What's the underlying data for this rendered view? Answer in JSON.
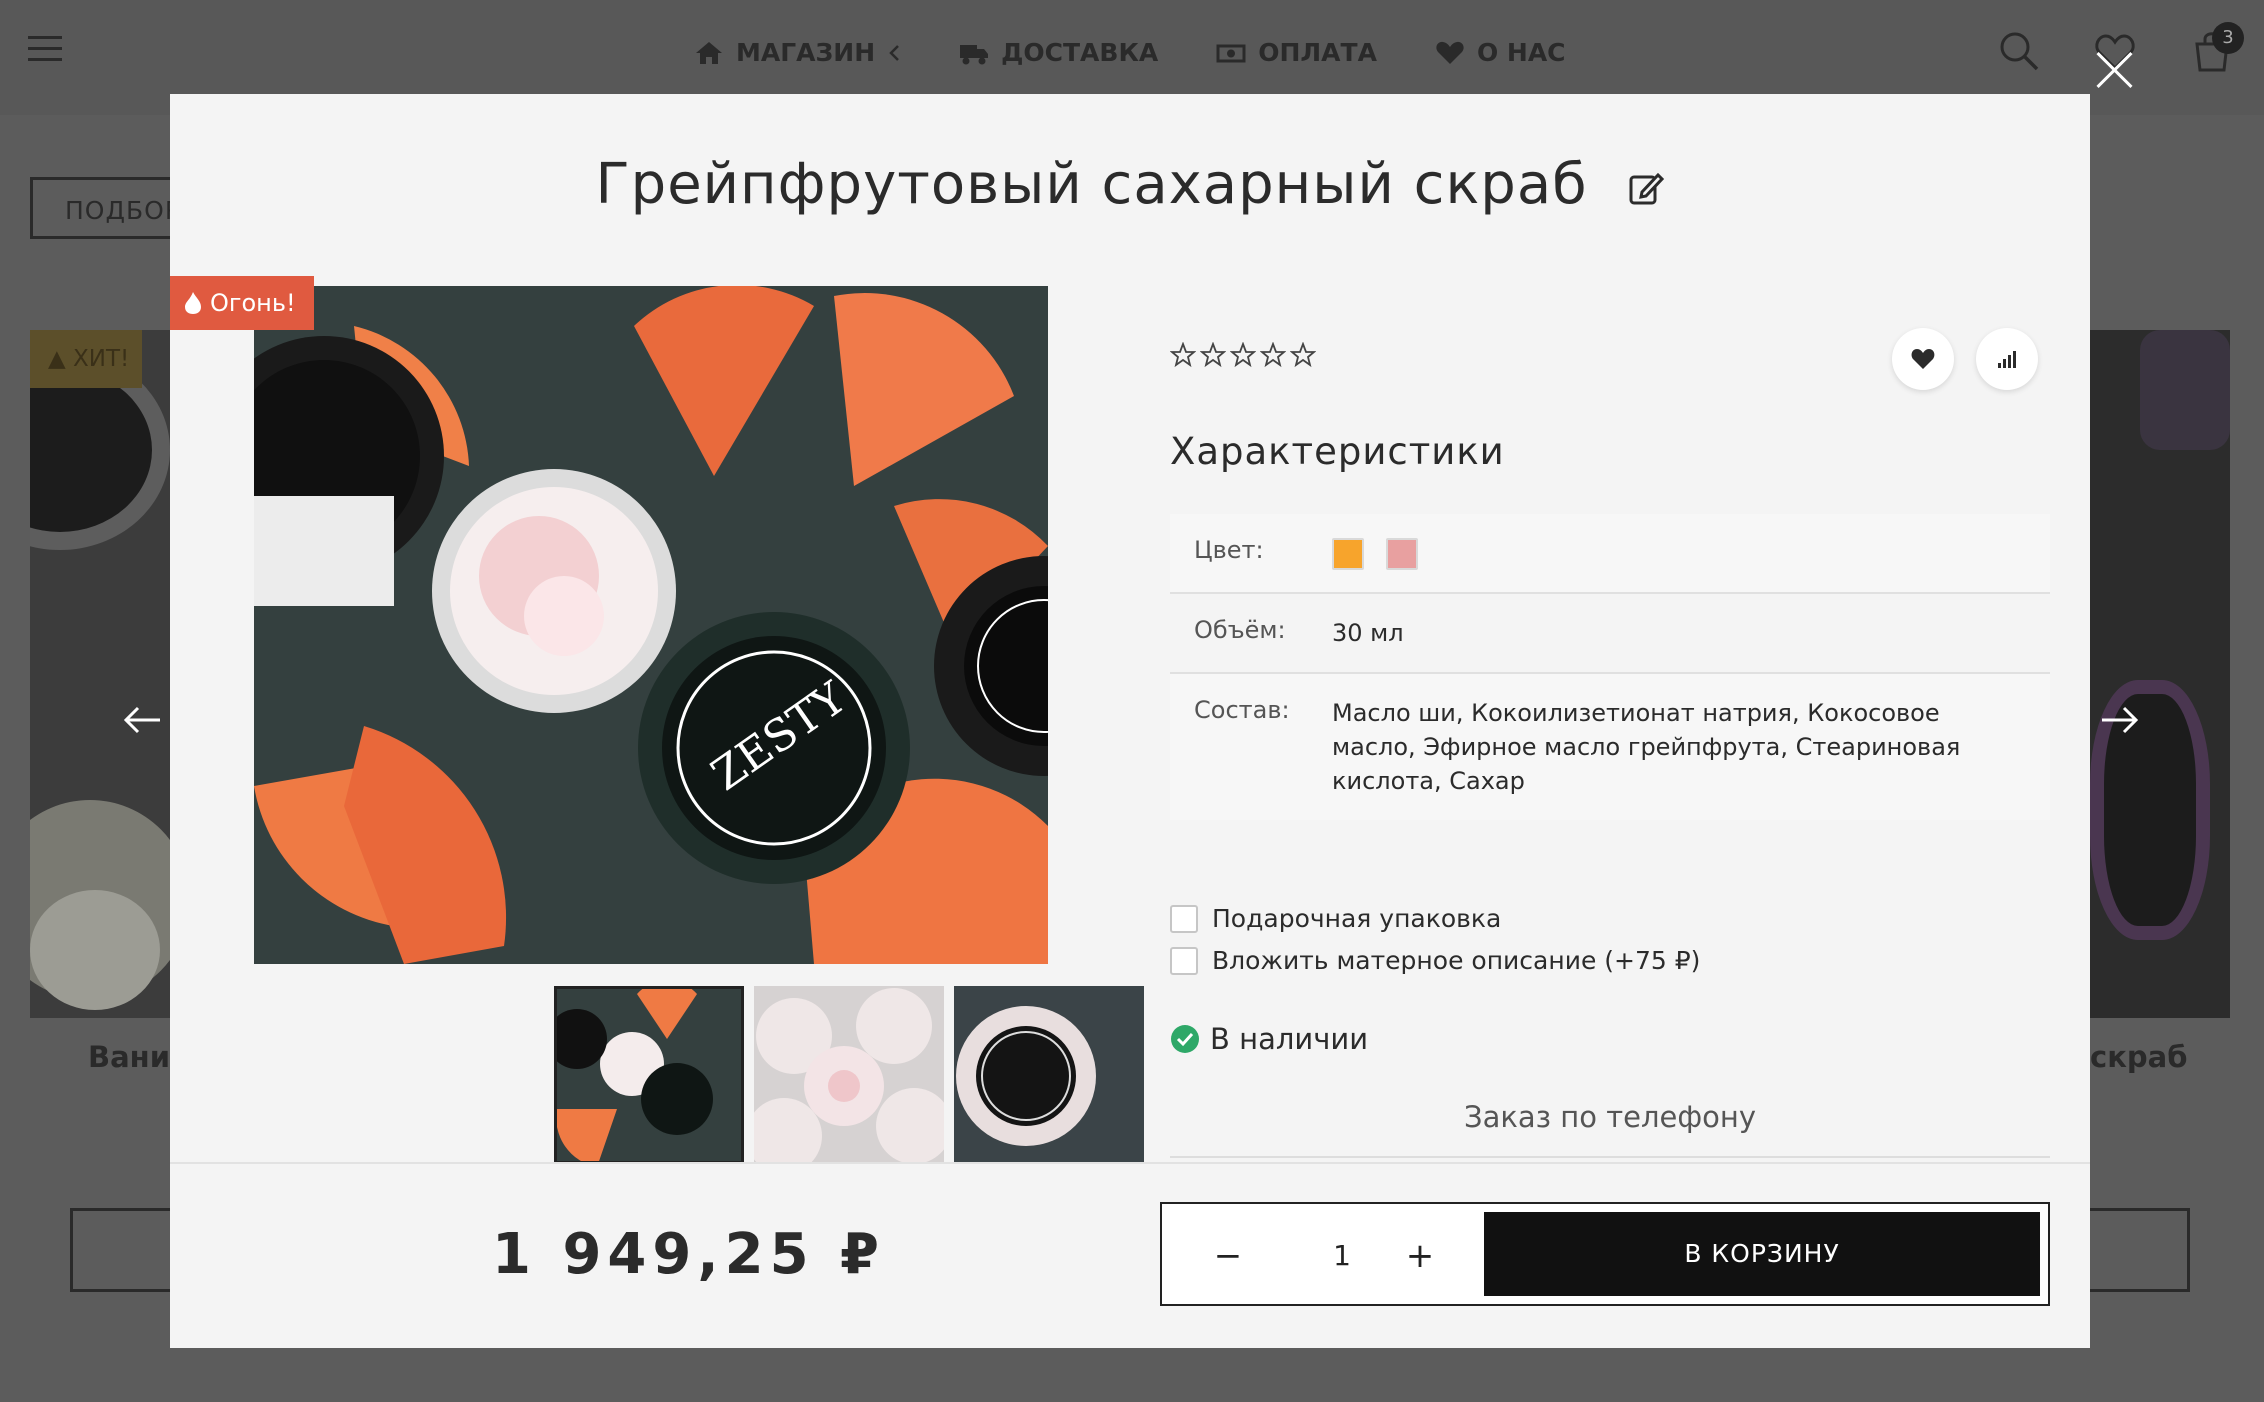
{
  "header": {
    "nav": [
      {
        "label": "МАГАЗИН",
        "icon": "home-icon"
      },
      {
        "label": "ДОСТАВКА",
        "icon": "truck-icon"
      },
      {
        "label": "ОПЛАТА",
        "icon": "money-icon"
      },
      {
        "label": "О НАС",
        "icon": "heart-icon"
      }
    ],
    "cart_count": "3"
  },
  "background": {
    "filter_label": "ПОДБОР",
    "hit_badge": "ХИТ!",
    "card_left_title": "Вани",
    "card_right_title": "скраб"
  },
  "product": {
    "title": "Грейпфрутовый сахарный скраб",
    "badge": "Огонь!",
    "rating_stars": 5,
    "specs_title": "Характеристики",
    "specs": [
      {
        "label": "Цвет:",
        "value": ""
      },
      {
        "label": "Объём:",
        "value": "30 мл"
      },
      {
        "label": "Состав:",
        "value": "Масло ши, Кокоилизетионат натрия, Кокосовое масло, Эфирное масло грейпфрута, Стеариновая кислота, Сахар"
      }
    ],
    "colors": [
      "#f7a42c",
      "#e8a0a0"
    ],
    "options": [
      {
        "label": "Подарочная упаковка"
      },
      {
        "label": "Вложить матерное описание (+75 ₽)"
      }
    ],
    "availability": "В наличии",
    "phone_order": "Заказ по телефону",
    "price": "1 949,25 ₽",
    "quantity": "1",
    "add_to_cart": "В КОРЗИНУ"
  },
  "colors": {
    "badge_fire": "#e05a40",
    "in_stock": "#2ea868",
    "cart_button": "#111111"
  }
}
